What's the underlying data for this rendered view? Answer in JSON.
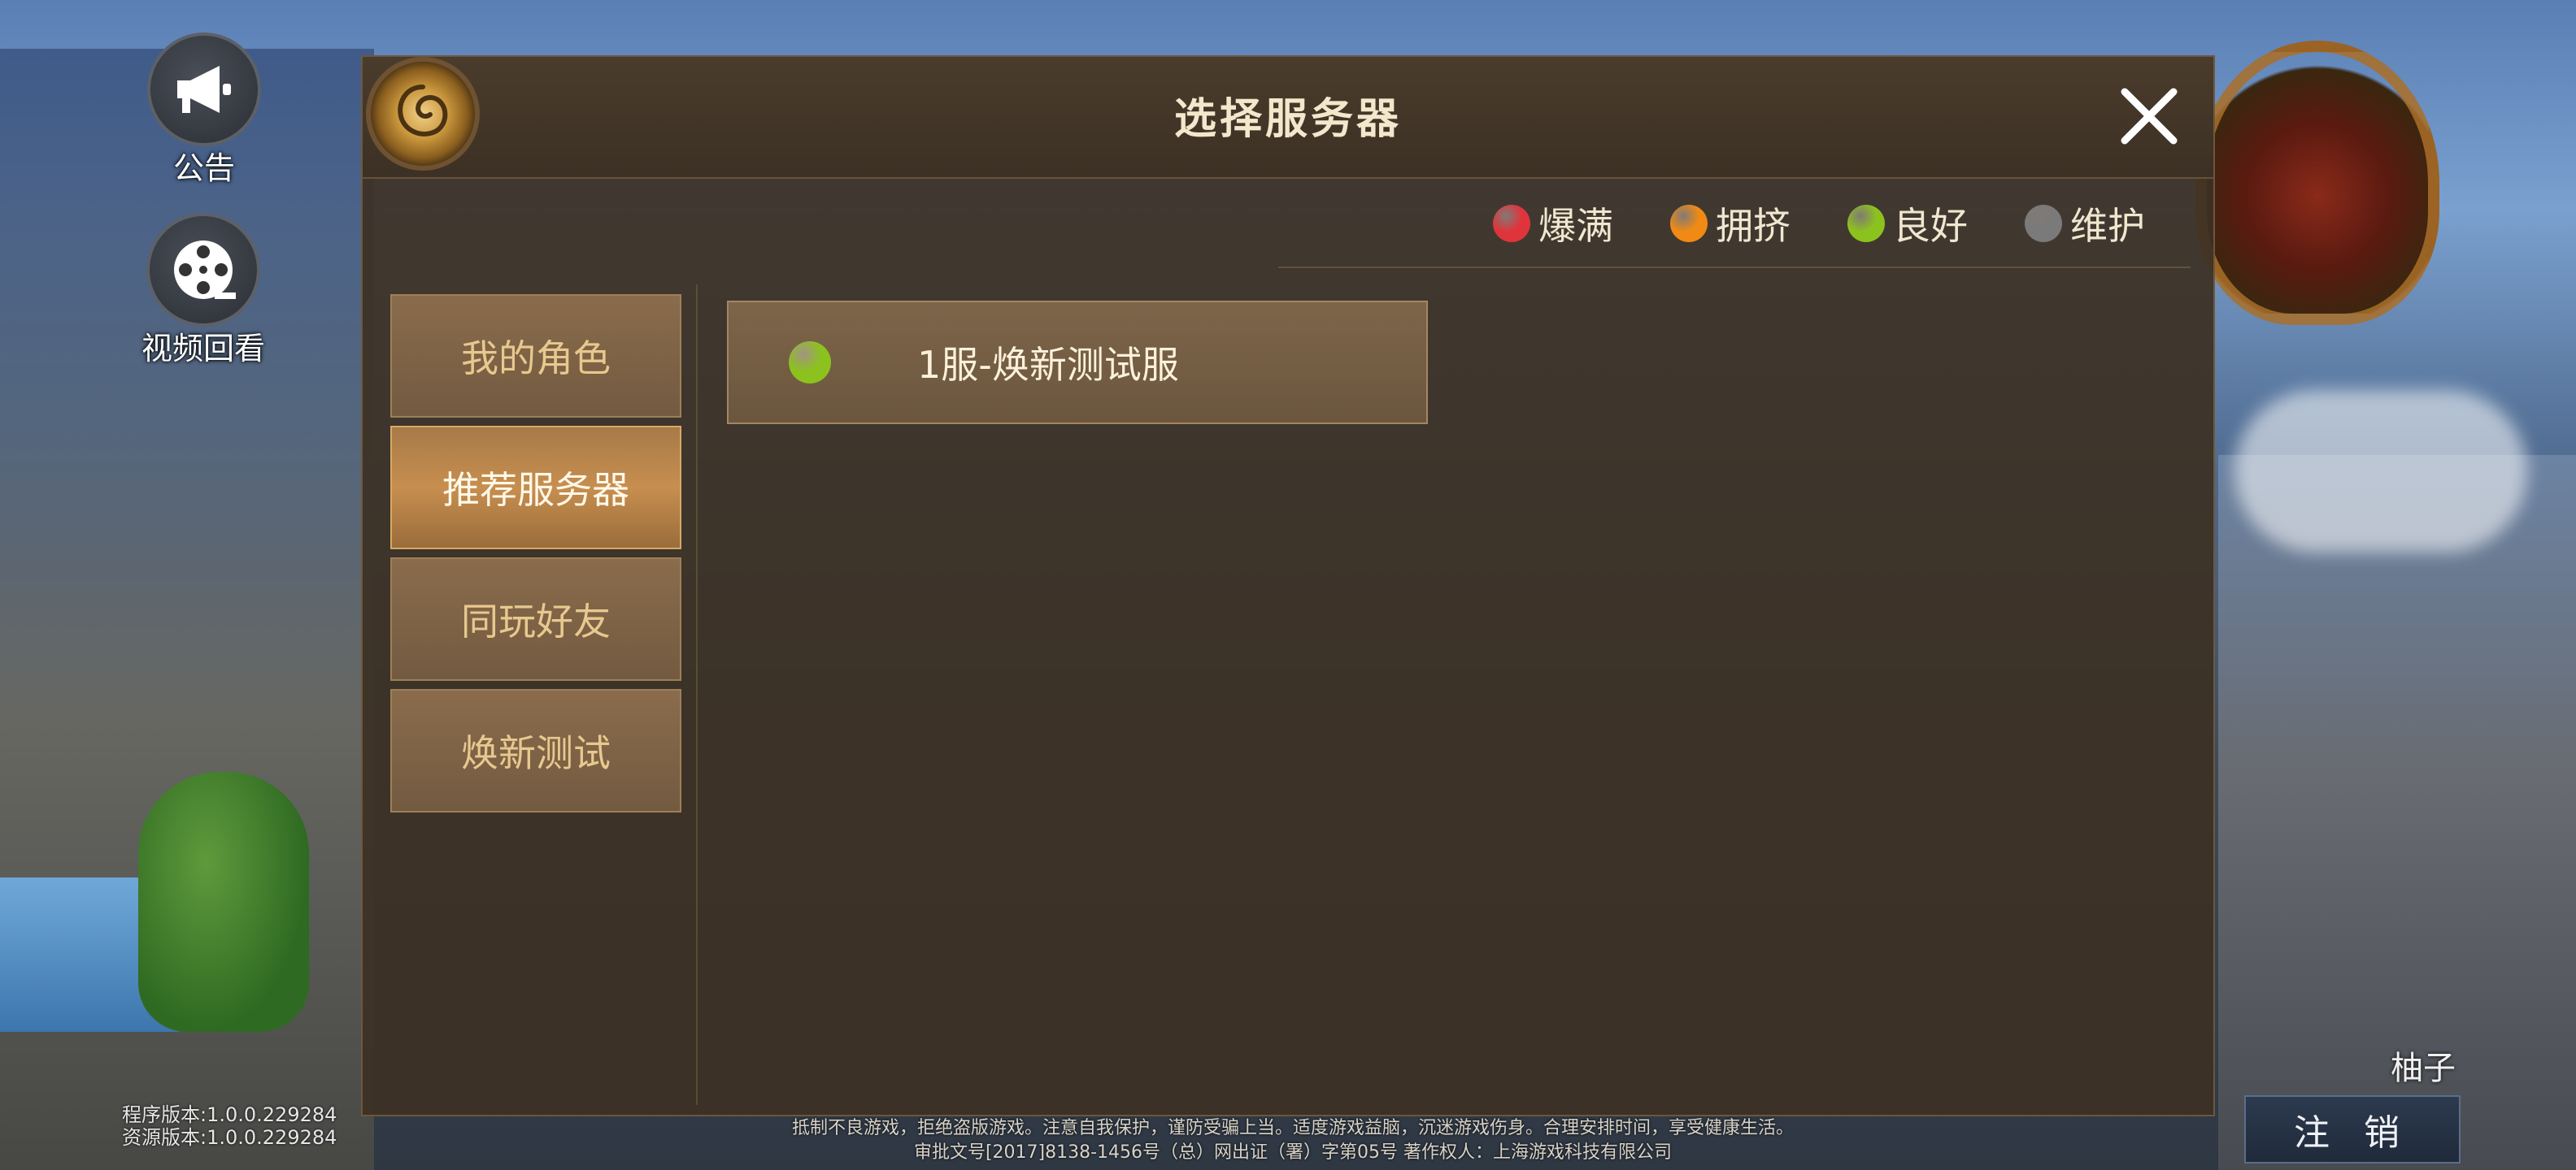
{
  "side_buttons": {
    "announcement_label": "公告",
    "video_replay_label": "视频回看"
  },
  "dialog": {
    "title": "选择服务器",
    "legend": [
      {
        "label": "爆满",
        "color": "#e0343c"
      },
      {
        "label": "拥挤",
        "color": "#f08a14"
      },
      {
        "label": "良好",
        "color": "#8cc21e"
      },
      {
        "label": "维护",
        "color": "#7a7a7a"
      }
    ],
    "tabs": [
      {
        "label": "我的角色",
        "active": false
      },
      {
        "label": "推荐服务器",
        "active": true
      },
      {
        "label": "同玩好友",
        "active": false
      },
      {
        "label": "焕新测试",
        "active": false
      }
    ],
    "servers": [
      {
        "name": "1服-焕新测试服",
        "status_color": "#8cc21e"
      }
    ]
  },
  "footer": {
    "version_program": "程序版本:1.0.0.229284",
    "version_resource": "资源版本:1.0.0.229284",
    "notice_line1": "抵制不良游戏，拒绝盗版游戏。注意自我保护，谨防受骗上当。适度游戏益脑，沉迷游戏伤身。合理安排时间，享受健康生活。",
    "notice_line2": "审批文号[2017]8138-1456号（总）网出证（署）字第05号 著作权人：上海游戏科技有限公司",
    "username": "柚子",
    "logout_label": "注 销"
  },
  "colors": {
    "accent_gold": "#c78e4f",
    "panel_bg": "#3c3024"
  }
}
